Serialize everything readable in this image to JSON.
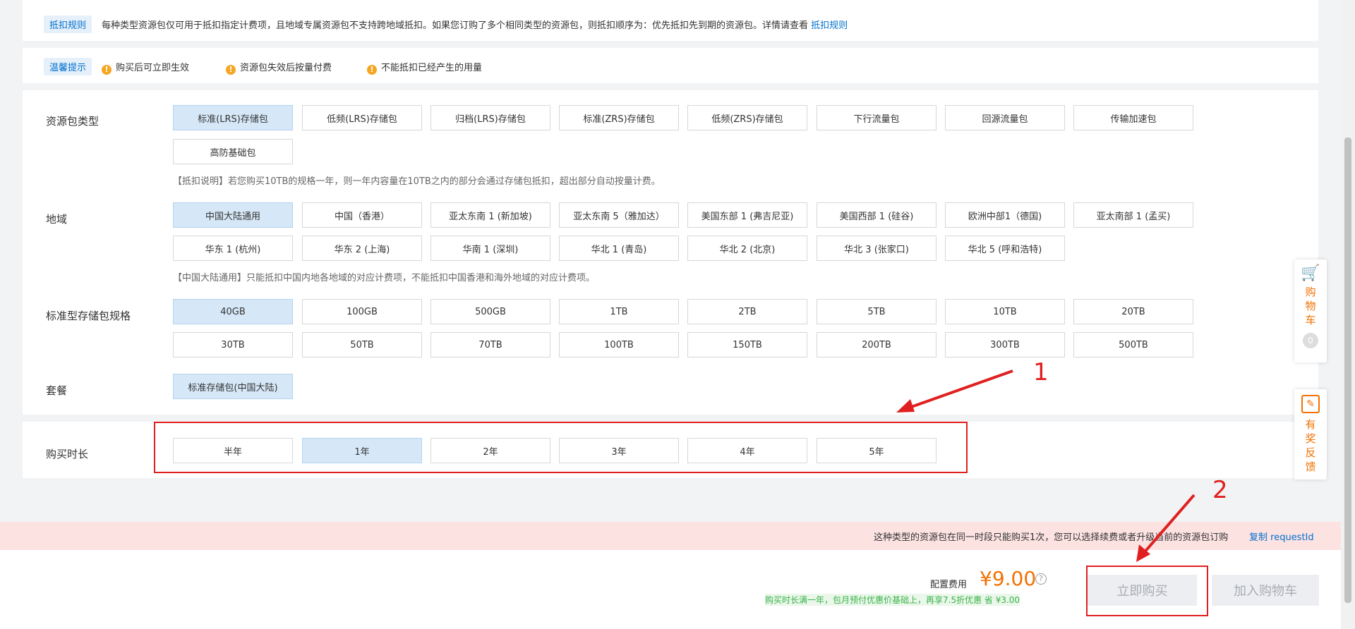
{
  "notice": {
    "rule_tag": "抵扣规则",
    "rule_text": "每种类型资源包仅可用于抵扣指定计费项，且地域专属资源包不支持跨地域抵扣。如果您订购了多个相同类型的资源包，则抵扣顺序为：优先抵扣先到期的资源包。详情请查看",
    "rule_link": "抵扣规则",
    "tip_tag": "温馨提示",
    "tips": [
      "购买后可立即生效",
      "资源包失效后按量付费",
      "不能抵扣已经产生的用量"
    ]
  },
  "package_type": {
    "label": "资源包类型",
    "options": [
      "标准(LRS)存储包",
      "低频(LRS)存储包",
      "归档(LRS)存储包",
      "标准(ZRS)存储包",
      "低频(ZRS)存储包",
      "下行流量包",
      "回源流量包",
      "传输加速包",
      "高防基础包"
    ],
    "selected": "标准(LRS)存储包",
    "note": "【抵扣说明】若您购买10TB的规格一年，则一年内容量在10TB之内的部分会通过存储包抵扣，超出部分自动按量计费。"
  },
  "region": {
    "label": "地域",
    "options": [
      "中国大陆通用",
      "中国（香港）",
      "亚太东南 1 (新加坡)",
      "亚太东南 5（雅加达）",
      "美国东部 1 (弗吉尼亚)",
      "美国西部 1 (硅谷)",
      "欧洲中部1（德国)",
      "亚太南部 1 (孟买)",
      "华东 1 (杭州)",
      "华东 2 (上海)",
      "华南 1 (深圳)",
      "华北 1 (青岛)",
      "华北 2 (北京)",
      "华北 3 (张家口)",
      "华北 5 (呼和浩特)"
    ],
    "selected": "中国大陆通用",
    "note": "【中国大陆通用】只能抵扣中国内地各地域的对应计费项，不能抵扣中国香港和海外地域的对应计费项。"
  },
  "spec": {
    "label": "标准型存储包规格",
    "options": [
      "40GB",
      "100GB",
      "500GB",
      "1TB",
      "2TB",
      "5TB",
      "10TB",
      "20TB",
      "30TB",
      "50TB",
      "70TB",
      "100TB",
      "150TB",
      "200TB",
      "300TB",
      "500TB"
    ],
    "selected": "40GB"
  },
  "plan": {
    "label": "套餐",
    "options": [
      "标准存储包(中国大陆)"
    ],
    "selected": "标准存储包(中国大陆)"
  },
  "duration": {
    "label": "购买时长",
    "options": [
      "半年",
      "1年",
      "2年",
      "3年",
      "4年",
      "5年"
    ],
    "selected": "1年"
  },
  "alert": {
    "text": "这种类型的资源包在同一时段只能购买1次，您可以选择续费或者升级当前的资源包订购",
    "link": "复制 requestId"
  },
  "footer": {
    "fee_label": "配置费用",
    "price": "¥9.00",
    "discount": "购买时长满一年，包月预付优惠价基础上，再享7.5折优惠 省 ¥3.00",
    "buy_label": "立即购买",
    "cart_label": "加入购物车"
  },
  "side": {
    "cart_label": "购物车",
    "cart_count": "0",
    "feedback_label": "有奖反馈"
  },
  "annotations": {
    "one": "1",
    "two": "2"
  },
  "colors": {
    "accent": "#0070cc",
    "price": "#f27100",
    "selected": "#d6e8f8",
    "annotation": "#e02020",
    "discount": "#3bb34a"
  }
}
